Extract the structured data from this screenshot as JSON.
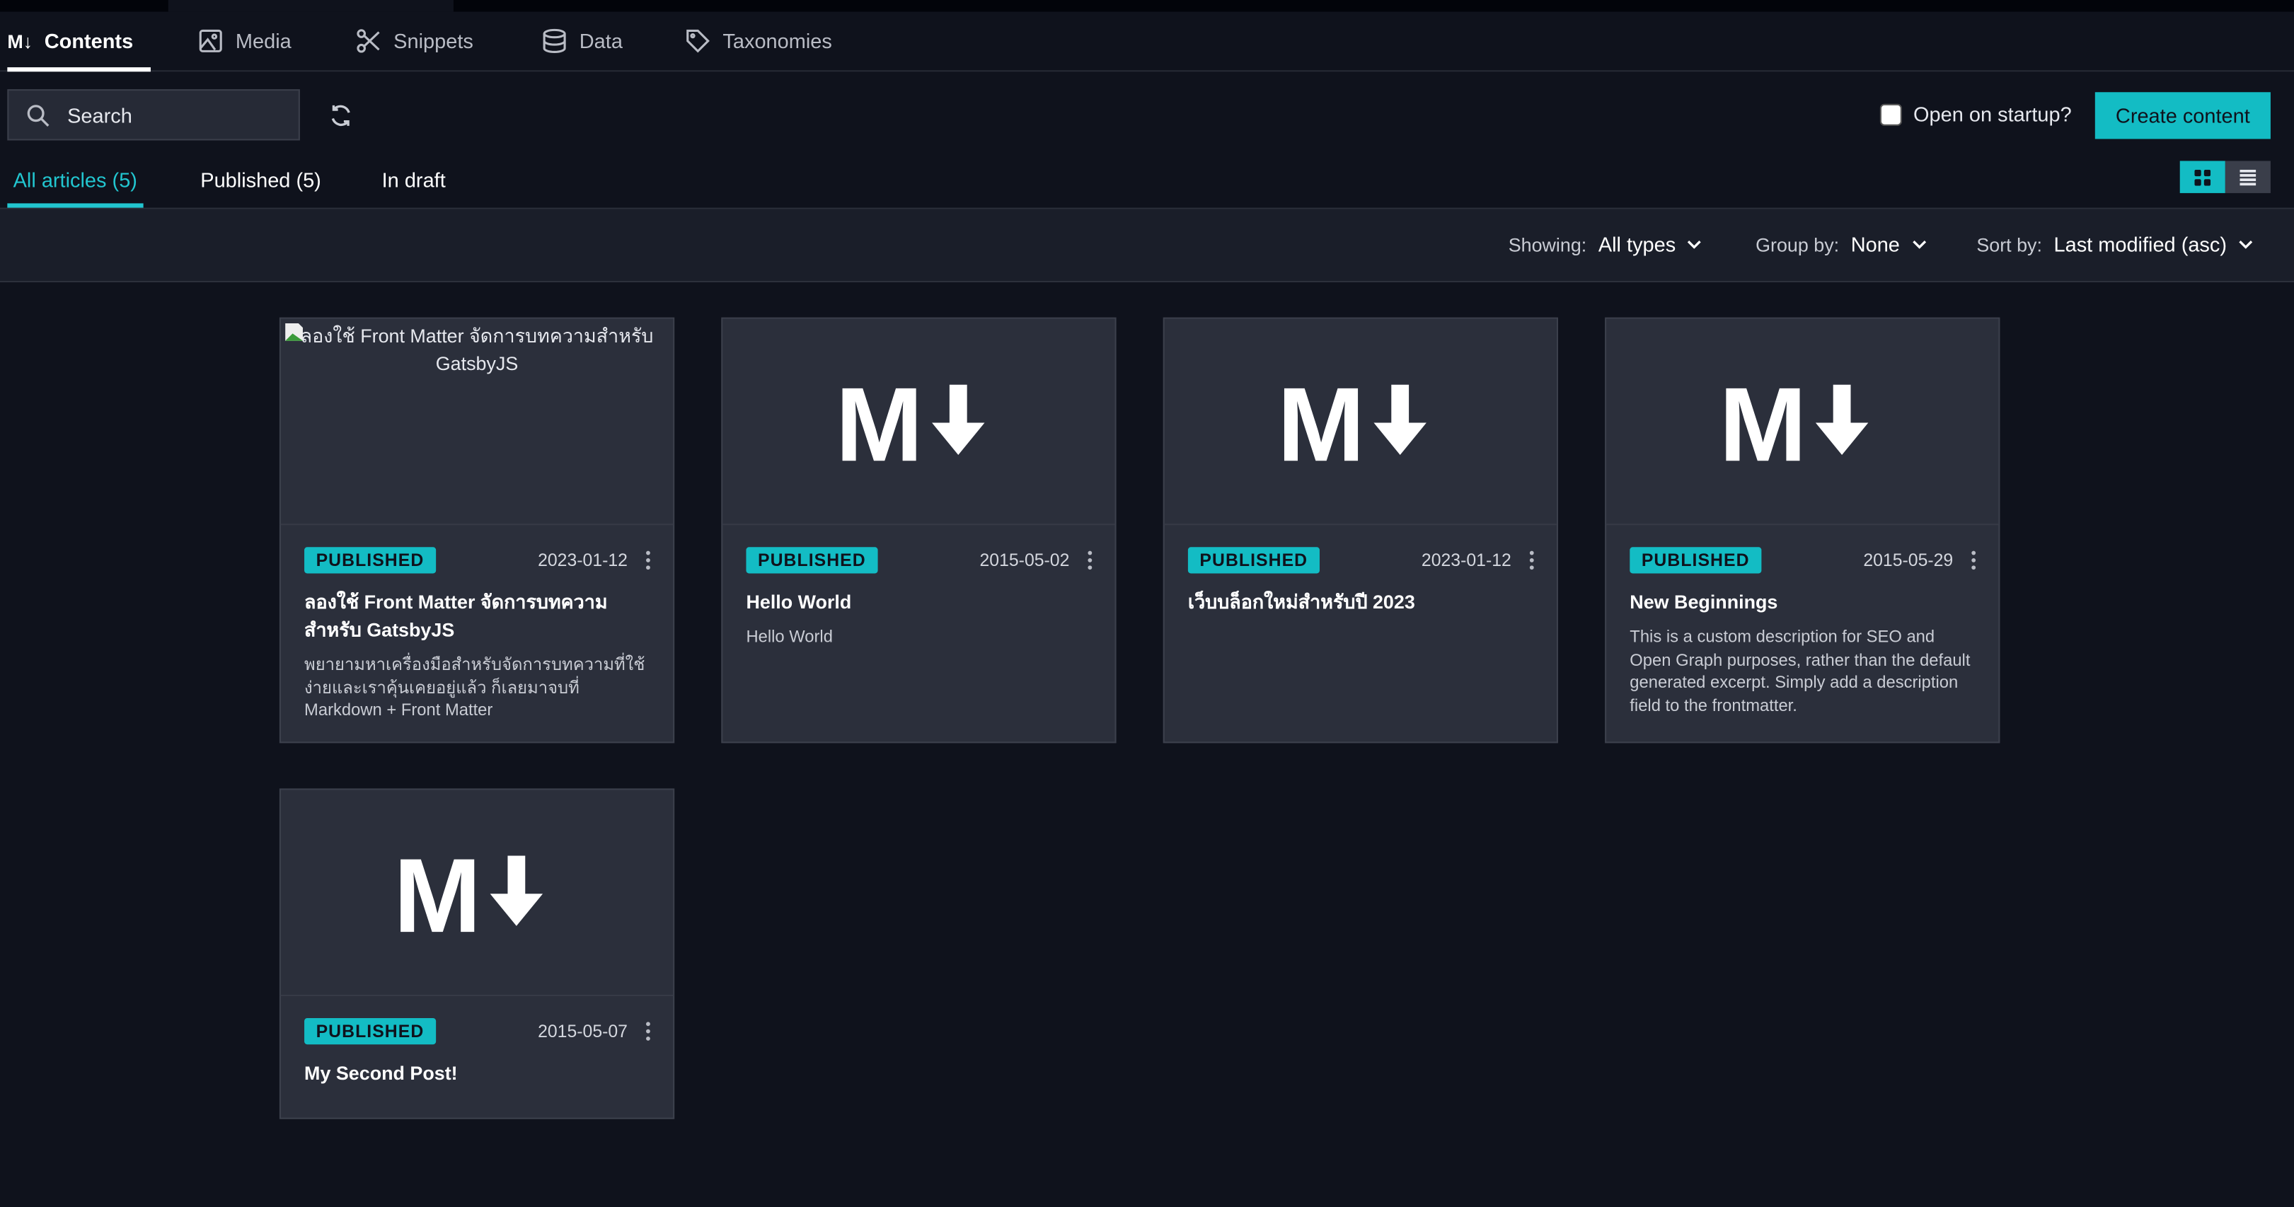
{
  "nav": {
    "tabs": [
      {
        "label": "Contents",
        "icon": "markdown-icon",
        "active": true
      },
      {
        "label": "Media",
        "icon": "image-icon"
      },
      {
        "label": "Snippets",
        "icon": "scissors-icon"
      },
      {
        "label": "Data",
        "icon": "database-icon"
      },
      {
        "label": "Taxonomies",
        "icon": "tag-icon"
      }
    ],
    "logo_text": "M↓"
  },
  "toolbar": {
    "search_placeholder": "Search",
    "startup_label": "Open on startup?",
    "startup_checked": false,
    "create_label": "Create content"
  },
  "subtabs": [
    {
      "label": "All articles (5)",
      "active": true
    },
    {
      "label": "Published (5)"
    },
    {
      "label": "In draft"
    }
  ],
  "filters": {
    "showing_label": "Showing:",
    "showing_value": "All types",
    "group_label": "Group by:",
    "group_value": "None",
    "sort_label": "Sort by:",
    "sort_value": "Last modified (asc)"
  },
  "colors": {
    "accent": "#13bcc4",
    "background": "#0f121c",
    "card": "#2b2f3b"
  },
  "cards": [
    {
      "image_alt": "ลองใช้ Front Matter จัดการบทความสำหรับ GatsbyJS",
      "status": "PUBLISHED",
      "date": "2023-01-12",
      "title": "ลองใช้ Front Matter จัดการบทความสำหรับ GatsbyJS",
      "description": "พยายามหาเครื่องมือสำหรับจัดการบทความที่ใช้ง่ายและเราคุ้นเคยอยู่แล้ว ก็เลยมาจบที่ Markdown + Front Matter"
    },
    {
      "status": "PUBLISHED",
      "date": "2015-05-02",
      "title": "Hello World",
      "description": "Hello World"
    },
    {
      "status": "PUBLISHED",
      "date": "2023-01-12",
      "title": "เว็บบล็อกใหม่สำหรับปี 2023",
      "description": ""
    },
    {
      "status": "PUBLISHED",
      "date": "2015-05-29",
      "title": "New Beginnings",
      "description": "This is a custom description for SEO and Open Graph purposes, rather than the default generated excerpt. Simply add a description field to the frontmatter."
    },
    {
      "status": "PUBLISHED",
      "date": "2015-05-07",
      "title": "My Second Post!",
      "description": ""
    }
  ]
}
